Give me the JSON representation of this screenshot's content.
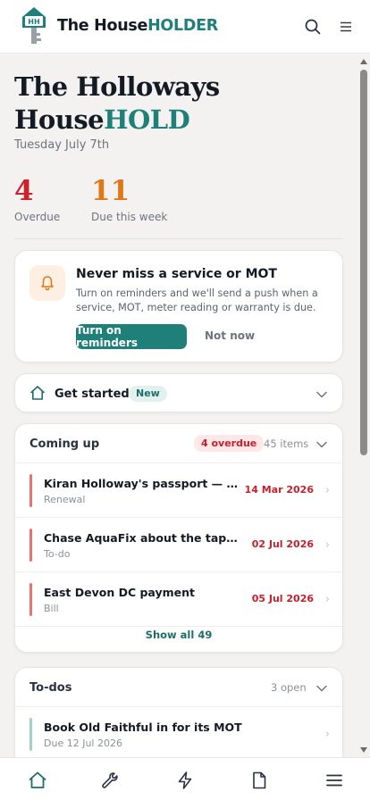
{
  "header": {
    "brand_main": "The House",
    "brand_accent": "HOLDER",
    "logo_text": "HH"
  },
  "household": {
    "title_line1": "The Holloways",
    "title_line2_main": "House",
    "title_line2_accent": "HOLD",
    "date": "Tuesday July 7th"
  },
  "stats": {
    "overdue": {
      "value": "4",
      "label": "Overdue"
    },
    "due_week": {
      "value": "11",
      "label": "Due this week"
    }
  },
  "reminder": {
    "title": "Never miss a service or MOT",
    "text": "Turn on reminders and we'll send a push when a service, MOT, meter reading or warranty is due.",
    "primary": "Turn on reminders",
    "secondary": "Not now"
  },
  "get_started": {
    "title": "Get started",
    "badge": "New"
  },
  "coming_up": {
    "title": "Coming up",
    "overdue_badge": "4 overdue",
    "count": "45 items",
    "items": [
      {
        "title": "Kiran Holloway's passport — time to renew",
        "sub": "Renewal",
        "due": "14 Mar 2026"
      },
      {
        "title": "Chase AquaFix about the tap. Again.",
        "sub": "To-do",
        "due": "02 Jul 2026"
      },
      {
        "title": "East Devon DC payment",
        "sub": "Bill",
        "due": "05 Jul 2026"
      }
    ],
    "show_all": "Show all 49"
  },
  "todos": {
    "title": "To-dos",
    "count": "3 open",
    "items": [
      {
        "title": "Book Old Faithful in for its MOT",
        "sub": "Due 12 Jul 2026"
      }
    ]
  },
  "colors": {
    "accent": "#1e8078",
    "overdue": "#d0202b",
    "due_week": "#e07818"
  },
  "nav": [
    "home-icon",
    "wrench-icon",
    "lightning-icon",
    "document-icon",
    "menu-icon"
  ]
}
